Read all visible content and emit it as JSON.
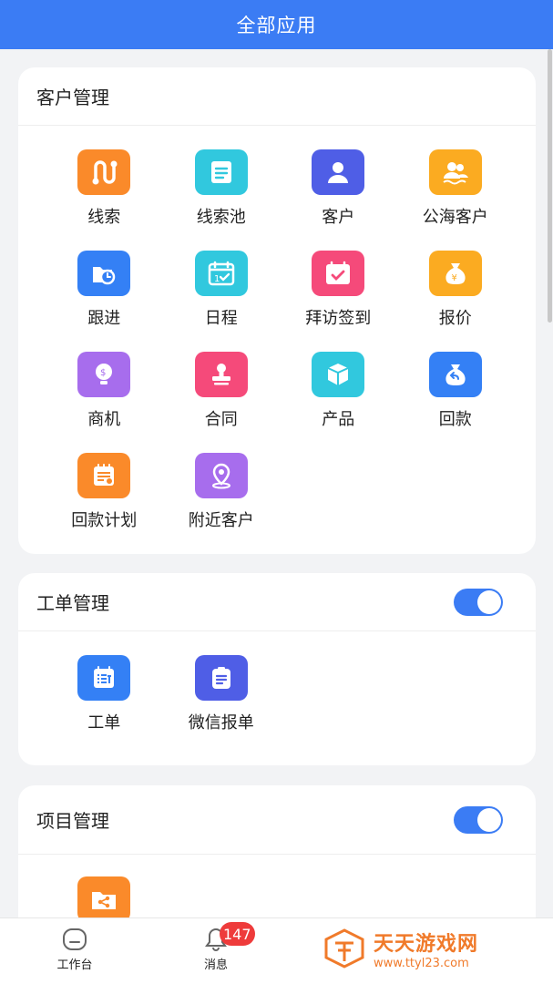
{
  "header": {
    "title": "全部应用"
  },
  "colors": {
    "brand": "#3b7cf4",
    "orange": "#fa8a2a",
    "cyan": "#31c8de",
    "indigo": "#4f5ee6",
    "amber": "#fbab21",
    "blue": "#3480f5",
    "pink": "#f54a7a",
    "purple": "#a76ded",
    "badge": "#ee3b3b"
  },
  "sections": {
    "customer": {
      "title": "客户管理",
      "apps": [
        {
          "label": "线索",
          "icon": "clue-route-icon",
          "color": "#fa8a2a"
        },
        {
          "label": "线索池",
          "icon": "clue-pool-icon",
          "color": "#31c8de"
        },
        {
          "label": "客户",
          "icon": "customer-user-icon",
          "color": "#4f5ee6"
        },
        {
          "label": "公海客户",
          "icon": "public-customers-icon",
          "color": "#fbab21"
        },
        {
          "label": "跟进",
          "icon": "follow-up-clock-icon",
          "color": "#3480f5"
        },
        {
          "label": "日程",
          "icon": "calendar-check-icon",
          "color": "#31c8de"
        },
        {
          "label": "拜访签到",
          "icon": "visit-checkin-icon",
          "color": "#f54a7a"
        },
        {
          "label": "报价",
          "icon": "money-bag-icon",
          "color": "#fbab21"
        },
        {
          "label": "商机",
          "icon": "opportunity-bulb-icon",
          "color": "#a76ded"
        },
        {
          "label": "合同",
          "icon": "contract-stamp-icon",
          "color": "#f54a7a"
        },
        {
          "label": "产品",
          "icon": "product-box-icon",
          "color": "#31c8de"
        },
        {
          "label": "回款",
          "icon": "payment-back-bag-icon",
          "color": "#3480f5"
        },
        {
          "label": "回款计划",
          "icon": "payment-plan-icon",
          "color": "#fa8a2a"
        },
        {
          "label": "附近客户",
          "icon": "nearby-location-icon",
          "color": "#a76ded"
        }
      ]
    },
    "workorder": {
      "title": "工单管理",
      "toggle_on": true,
      "apps": [
        {
          "label": "工单",
          "icon": "work-order-icon",
          "color": "#3480f5"
        },
        {
          "label": "微信报单",
          "icon": "wechat-report-icon",
          "color": "#4f5ee6"
        }
      ]
    },
    "project": {
      "title": "项目管理",
      "toggle_on": true,
      "apps": [
        {
          "label": "",
          "icon": "project-folder-share-icon",
          "color": "#fa8a2a"
        }
      ]
    }
  },
  "bottom_nav": {
    "workbench_label": "工作台",
    "messages_label": "消息",
    "messages_badge": "147"
  },
  "watermark": {
    "name": "天天游戏网",
    "url": "www.ttyl23.com"
  }
}
